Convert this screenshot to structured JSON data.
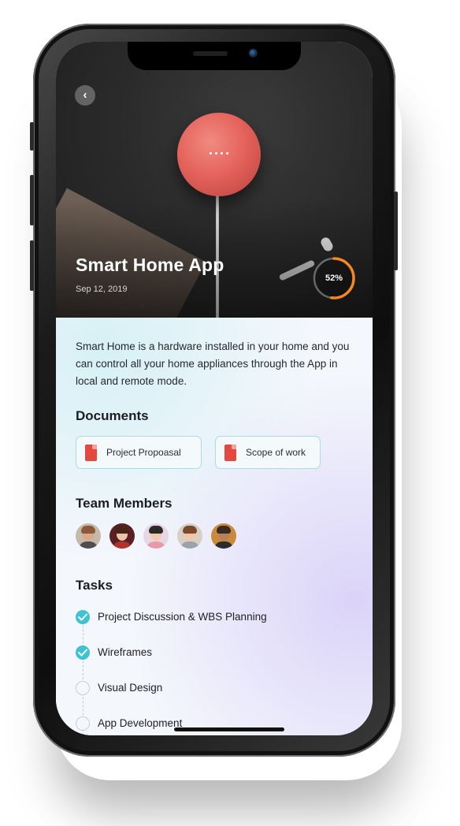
{
  "hero": {
    "title": "Smart Home App",
    "date": "Sep 12, 2019",
    "progress_label": "52%",
    "progress_value": 0.52,
    "accent_color": "#f5891f"
  },
  "description": "Smart Home is a hardware installed in your home and you can control all your home appliances through the App in local and remote mode.",
  "documents": {
    "title": "Documents",
    "items": [
      {
        "label": "Project Propoasal",
        "icon": "pdf-file-icon"
      },
      {
        "label": "Scope of work",
        "icon": "pdf-file-icon"
      }
    ]
  },
  "team": {
    "title": "Team Members",
    "members": [
      "avatar-1",
      "avatar-2",
      "avatar-3",
      "avatar-4",
      "avatar-5"
    ]
  },
  "tasks": {
    "title": "Tasks",
    "items": [
      {
        "label": "Project Discussion & WBS Planning",
        "done": true
      },
      {
        "label": "Wireframes",
        "done": true
      },
      {
        "label": "Visual Design",
        "done": false
      },
      {
        "label": "App Development",
        "done": false
      }
    ],
    "done_color": "#3ec3d1"
  }
}
